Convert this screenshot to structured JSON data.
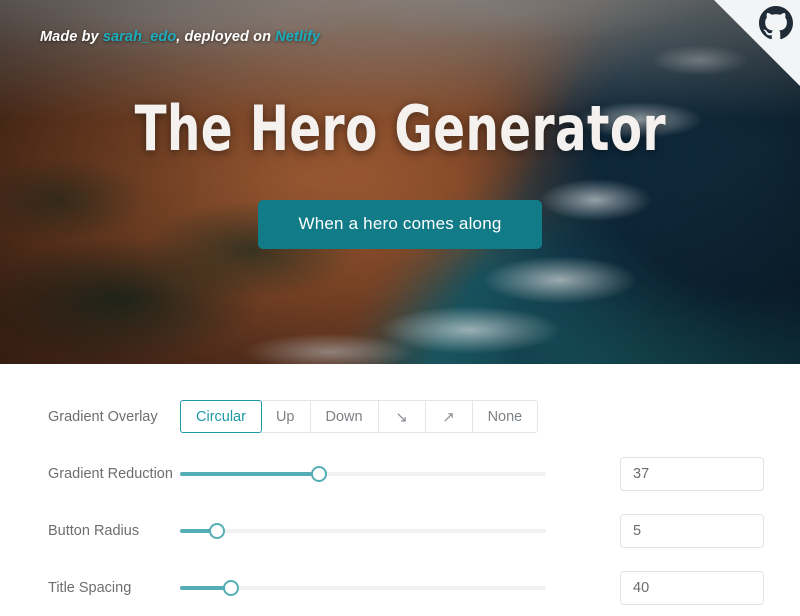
{
  "hero": {
    "byline": {
      "prefix": "Made by ",
      "author": "sarah_edo",
      "middle": ", deployed on ",
      "host": "Netlify"
    },
    "title": "The Hero Generator",
    "button_label": "When a hero comes along",
    "corner_ribbon_icon": "github-octocat-icon",
    "accent_color": "#117b87",
    "link_color": "#1cadbd"
  },
  "controls": {
    "gradient_overlay": {
      "label": "Gradient Overlay",
      "selected": "Circular",
      "options": [
        {
          "label": "Circular",
          "type": "text",
          "selected": true
        },
        {
          "label": "Up",
          "type": "text",
          "selected": false
        },
        {
          "label": "Down",
          "type": "text",
          "selected": false
        },
        {
          "label": "↘",
          "type": "icon",
          "icon_name": "arrow-down-right-icon",
          "selected": false
        },
        {
          "label": "↗",
          "type": "icon",
          "icon_name": "arrow-up-right-icon",
          "selected": false
        },
        {
          "label": "None",
          "type": "text",
          "selected": false
        }
      ]
    },
    "sliders": [
      {
        "label": "Gradient Reduction",
        "value": "37",
        "percent": 38
      },
      {
        "label": "Button Radius",
        "value": "5",
        "percent": 10
      },
      {
        "label": "Title Spacing",
        "value": "40",
        "percent": 14
      }
    ],
    "slider_accent": "#55aeb4",
    "segment_active_color": "#1d9aa6"
  }
}
